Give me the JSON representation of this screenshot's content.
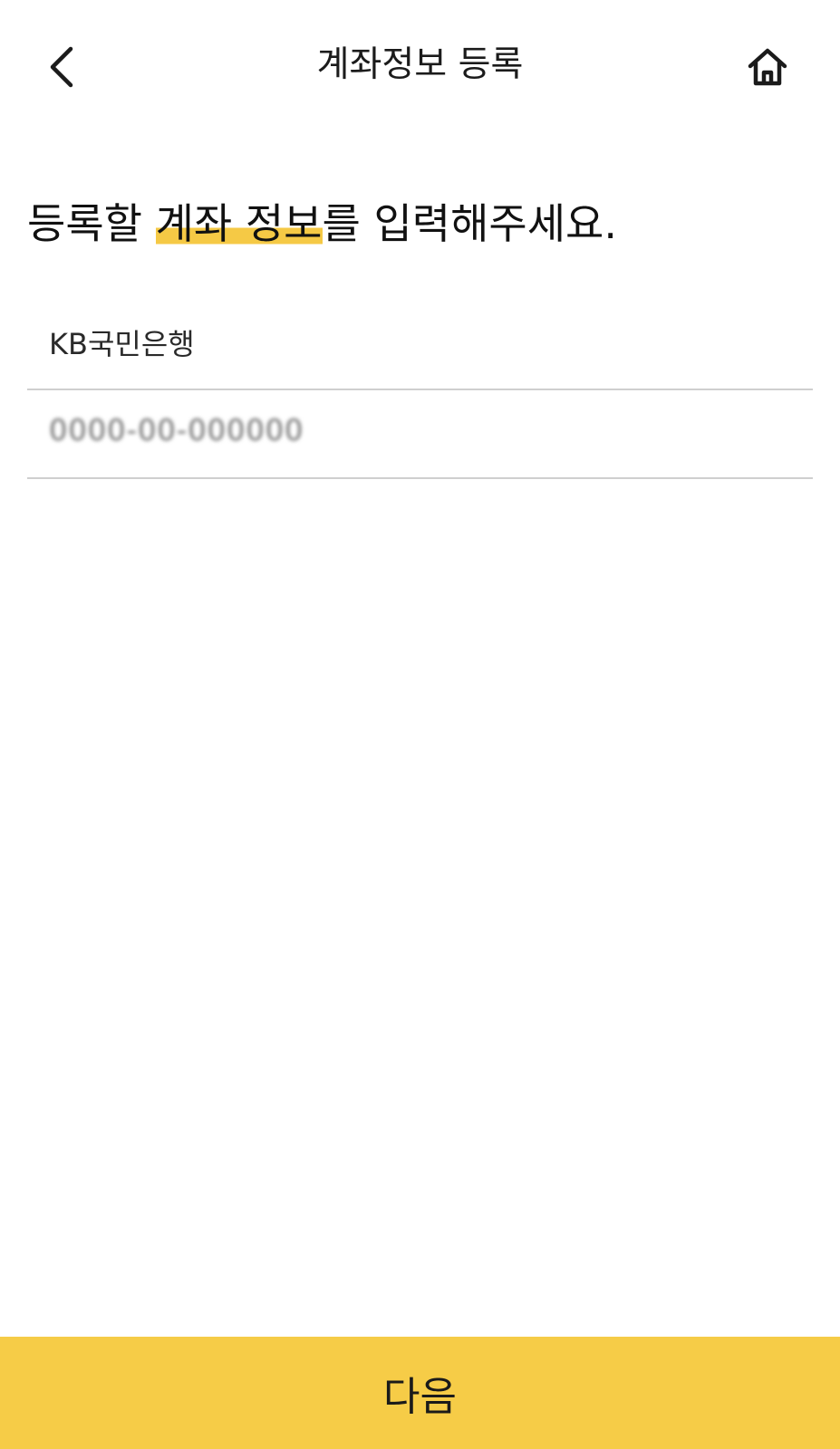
{
  "header": {
    "title": "계좌정보 등록",
    "back_icon": "chevron-left-icon",
    "home_icon": "home-icon"
  },
  "headline": {
    "part1": "등록할 ",
    "highlight": "계좌 정보",
    "part2": "를 입력해주세요."
  },
  "form": {
    "bank_name": "KB국민은행",
    "account_number": "0000-00-000000"
  },
  "footer": {
    "next_label": "다음"
  },
  "colors": {
    "accent": "#f6cc47",
    "highlight": "#f5c945",
    "divider": "#cfcfcf"
  }
}
